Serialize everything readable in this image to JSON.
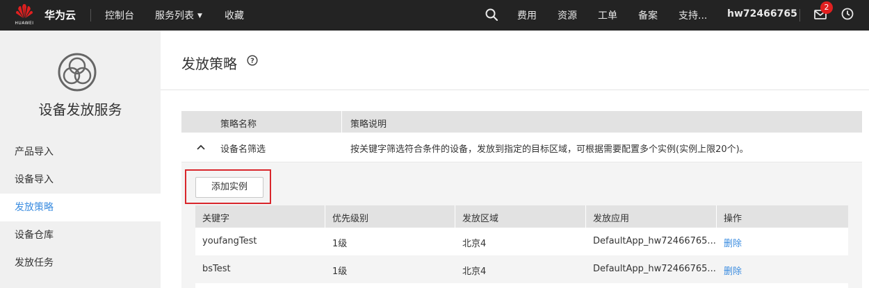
{
  "topbar": {
    "logo_text": "HUAWEI",
    "brand": "华为云",
    "nav": {
      "console": "控制台",
      "service_list": "服务列表",
      "favorites": "收藏"
    },
    "right": {
      "fees": "费用",
      "resources": "资源",
      "tickets": "工单",
      "filing": "备案",
      "support": "支持...",
      "user": "hw72466765",
      "unread_count": "2"
    },
    "icons": [
      "huawei-logo-icon",
      "chevron-down-icon",
      "search-icon",
      "mail-icon",
      "clock-icon"
    ]
  },
  "sidebar": {
    "service_name": "设备发放服务",
    "items": [
      {
        "label": "产品导入",
        "active": false
      },
      {
        "label": "设备导入",
        "active": false
      },
      {
        "label": "发放策略",
        "active": true
      },
      {
        "label": "设备仓库",
        "active": false
      },
      {
        "label": "发放任务",
        "active": false
      }
    ]
  },
  "page": {
    "title": "发放策略"
  },
  "policy_table": {
    "headers": [
      "策略名称",
      "策略说明"
    ],
    "rows": [
      {
        "name": "设备名筛选",
        "description": "按关键字筛选符合条件的设备，发放到指定的目标区域，可根据需要配置多个实例(实例上限20个)。"
      }
    ]
  },
  "instances": {
    "add_button": "添加实例",
    "headers": [
      "关键字",
      "优先级别",
      "发放区域",
      "发放应用",
      "操作"
    ],
    "rows": [
      {
        "keyword": "youfangTest",
        "priority": "1级",
        "region": "北京4",
        "app": "DefaultApp_hw72466765...",
        "action": "删除"
      },
      {
        "keyword": "bsTest",
        "priority": "1级",
        "region": "北京4",
        "app": "DefaultApp_hw72466765...",
        "action": "删除"
      }
    ]
  },
  "colors": {
    "topbar_bg": "#232323",
    "accent": "#3c8de0",
    "highlight_border": "#d9262b",
    "badge": "#e02020"
  }
}
